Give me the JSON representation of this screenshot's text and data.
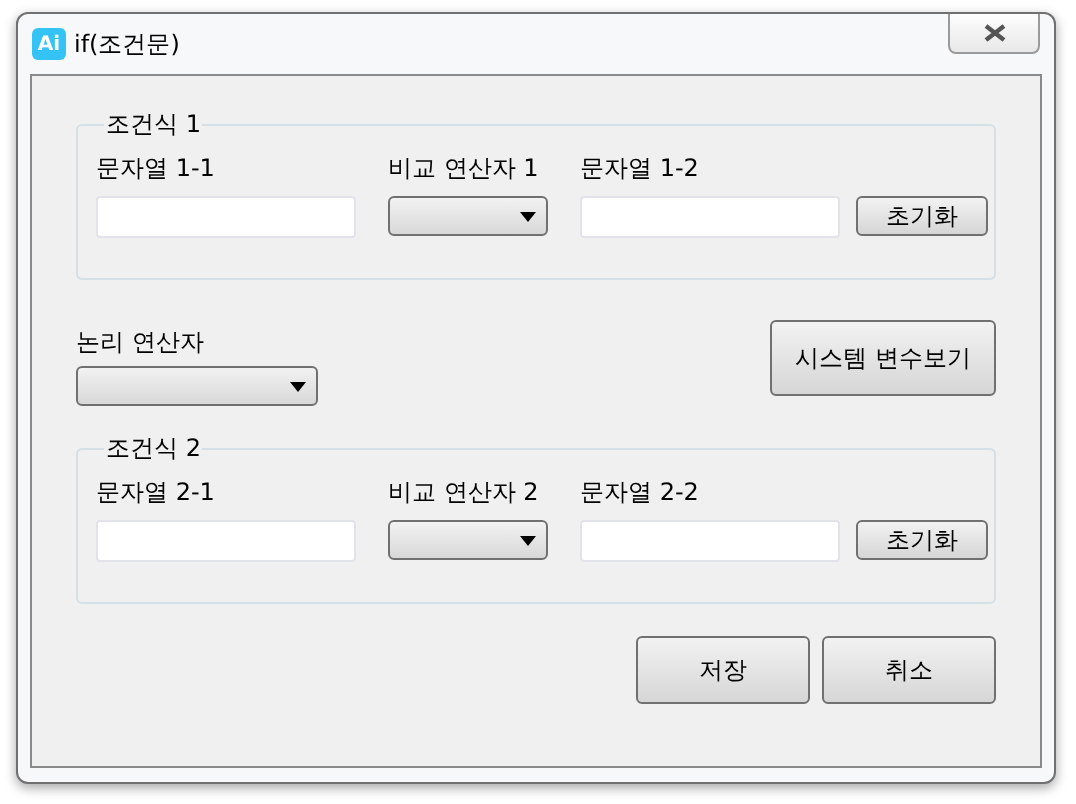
{
  "window": {
    "title": "if(조건문)",
    "app_icon_text": "Ai"
  },
  "conditions": [
    {
      "title": "조건식 1",
      "string_a_label": "문자열 1-1",
      "operator_label": "비교 연산자 1",
      "string_b_label": "문자열 1-2",
      "reset_button": "초기화"
    },
    {
      "title": "조건식 2",
      "string_a_label": "문자열 2-1",
      "operator_label": "비교 연산자 2",
      "string_b_label": "문자열 2-2",
      "reset_button": "초기화"
    }
  ],
  "logic_operator": {
    "label": "논리 연산자"
  },
  "system_vars_button": "시스템 변수보기",
  "buttons": [
    "저장",
    "취소"
  ]
}
